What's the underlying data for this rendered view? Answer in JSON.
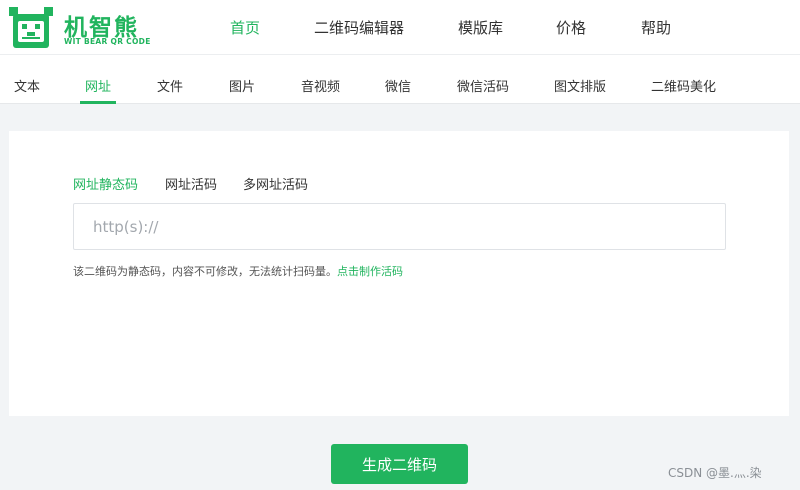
{
  "header": {
    "logo": {
      "name": "机智熊",
      "subtitle": "WIT BEAR QR CODE"
    },
    "nav": [
      {
        "label": "首页",
        "active": true
      },
      {
        "label": "二维码编辑器",
        "active": false
      },
      {
        "label": "模版库",
        "active": false
      },
      {
        "label": "价格",
        "active": false
      },
      {
        "label": "帮助",
        "active": false
      }
    ]
  },
  "categories": [
    {
      "label": "文本",
      "active": false
    },
    {
      "label": "网址",
      "active": true
    },
    {
      "label": "文件",
      "active": false
    },
    {
      "label": "图片",
      "active": false
    },
    {
      "label": "音视频",
      "active": false
    },
    {
      "label": "微信",
      "active": false
    },
    {
      "label": "微信活码",
      "active": false
    },
    {
      "label": "图文排版",
      "active": false
    },
    {
      "label": "二维码美化",
      "active": false
    }
  ],
  "url_panel": {
    "tabs": [
      {
        "label": "网址静态码",
        "active": true
      },
      {
        "label": "网址活码",
        "active": false
      },
      {
        "label": "多网址活码",
        "active": false
      }
    ],
    "input": {
      "value": "",
      "placeholder": "http(s)://"
    },
    "hint": {
      "text": "该二维码为静态码，内容不可修改，无法统计扫码量。",
      "link": "点击制作活码"
    }
  },
  "actions": {
    "generate_label": "生成二维码"
  },
  "watermark": "CSDN @墨.灬.染",
  "colors": {
    "accent": "#21b45e",
    "page_bg": "#f2f4f6",
    "panel_bg": "#ffffff"
  }
}
